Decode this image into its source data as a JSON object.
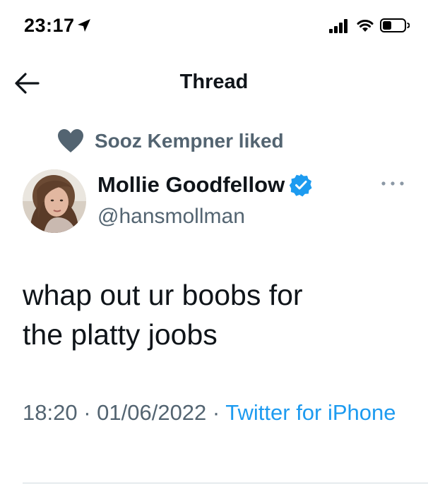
{
  "status_bar": {
    "time": "23:17"
  },
  "nav": {
    "title": "Thread"
  },
  "social_context": {
    "text": "Sooz Kempner liked"
  },
  "tweet": {
    "author_name": "Mollie Goodfellow",
    "author_handle": "@hansmollman",
    "verified": true,
    "text": "whap out ur boobs for\nthe platty joobs",
    "time": "18:20",
    "date": "01/06/2022",
    "separator": " · ",
    "source": "Twitter for iPhone"
  },
  "colors": {
    "text_primary": "#0f1419",
    "text_secondary": "#536471",
    "accent": "#1d9bf0",
    "divider": "#cfd9de"
  },
  "icons": {
    "location": "location-arrow-icon",
    "signal": "cellular-signal-icon",
    "wifi": "wifi-icon",
    "battery": "battery-icon",
    "back": "back-arrow-icon",
    "heart": "heart-icon",
    "verified": "verified-badge-icon",
    "more": "more-options-icon"
  }
}
